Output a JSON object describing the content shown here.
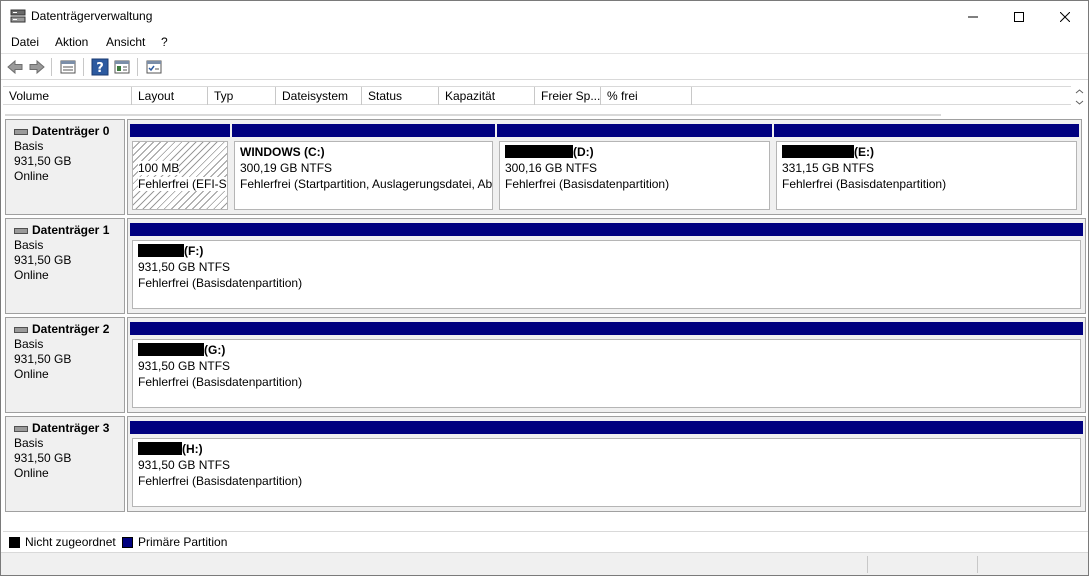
{
  "window": {
    "title": "Datenträgerverwaltung",
    "controls": {
      "minimize": "minimize",
      "maximize": "maximize",
      "close": "close"
    }
  },
  "menu": [
    "Datei",
    "Aktion",
    "Ansicht",
    "?"
  ],
  "toolbar": [
    "back-icon",
    "forward-icon",
    "properties-icon",
    "help-icon",
    "show-hide-icon",
    "settings-icon"
  ],
  "columns": [
    "Volume",
    "Layout",
    "Typ",
    "Dateisystem",
    "Status",
    "Kapazität",
    "Freier Sp...",
    "% frei"
  ],
  "colors": {
    "primary_partition": "#00007f",
    "unallocated": "#000000"
  },
  "disks": [
    {
      "name": "Datenträger 0",
      "type": "Basis",
      "size": "931,50 GB",
      "status": "Online",
      "partitions": [
        {
          "label": "",
          "size": "100 MB",
          "status": "Fehlerfrei (EFI-Sy"
        },
        {
          "label": "WINDOWS  (C:)",
          "size": "300,19 GB NTFS",
          "status": "Fehlerfrei (Startpartition, Auslagerungsdatei, Ab"
        },
        {
          "label": "(D:)",
          "size": "300,16 GB NTFS",
          "status": "Fehlerfrei (Basisdatenpartition)"
        },
        {
          "label": "(E:)",
          "size": "331,15 GB NTFS",
          "status": "Fehlerfrei (Basisdatenpartition)"
        }
      ]
    },
    {
      "name": "Datenträger 1",
      "type": "Basis",
      "size": "931,50 GB",
      "status": "Online",
      "partitions": [
        {
          "label": "(F:)",
          "size": "931,50 GB NTFS",
          "status": "Fehlerfrei (Basisdatenpartition)"
        }
      ]
    },
    {
      "name": "Datenträger 2",
      "type": "Basis",
      "size": "931,50 GB",
      "status": "Online",
      "partitions": [
        {
          "label": "(G:)",
          "size": "931,50 GB NTFS",
          "status": "Fehlerfrei (Basisdatenpartition)"
        }
      ]
    },
    {
      "name": "Datenträger 3",
      "type": "Basis",
      "size": "931,50 GB",
      "status": "Online",
      "partitions": [
        {
          "label": "(H:)",
          "size": "931,50 GB NTFS",
          "status": "Fehlerfrei (Basisdatenpartition)"
        }
      ]
    }
  ],
  "legend": [
    {
      "label": "Nicht zugeordnet",
      "color": "#000000"
    },
    {
      "label": "Primäre Partition",
      "color": "#00007f"
    }
  ]
}
